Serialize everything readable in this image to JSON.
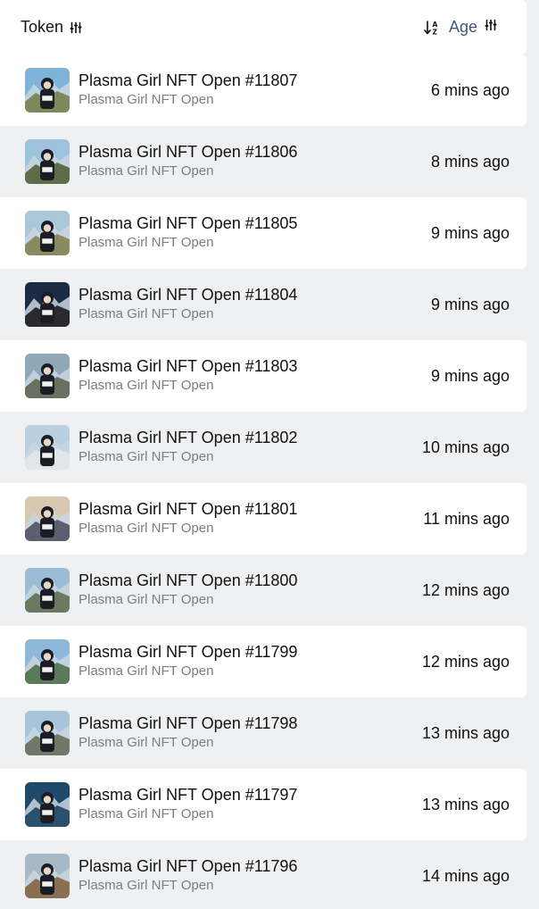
{
  "header": {
    "token_label": "Token",
    "age_label": "Age"
  },
  "rows": [
    {
      "name": "Plasma Girl NFT Open #11807",
      "collection": "Plasma Girl NFT Open",
      "age": "6 mins ago",
      "sky": "#7fb3d8",
      "ground": "#7a8a5a"
    },
    {
      "name": "Plasma Girl NFT Open #11806",
      "collection": "Plasma Girl NFT Open",
      "age": "8 mins ago",
      "sky": "#9cc2dd",
      "ground": "#5d6d4a"
    },
    {
      "name": "Plasma Girl NFT Open #11805",
      "collection": "Plasma Girl NFT Open",
      "age": "9 mins ago",
      "sky": "#a9c7d9",
      "ground": "#8a8a60"
    },
    {
      "name": "Plasma Girl NFT Open #11804",
      "collection": "Plasma Girl NFT Open",
      "age": "9 mins ago",
      "sky": "#1c2a44",
      "ground": "#2a2a30"
    },
    {
      "name": "Plasma Girl NFT Open #11803",
      "collection": "Plasma Girl NFT Open",
      "age": "9 mins ago",
      "sky": "#8fa8b8",
      "ground": "#6a7060"
    },
    {
      "name": "Plasma Girl NFT Open #11802",
      "collection": "Plasma Girl NFT Open",
      "age": "10 mins ago",
      "sky": "#b8d0e0",
      "ground": "#dfe6ea"
    },
    {
      "name": "Plasma Girl NFT Open #11801",
      "collection": "Plasma Girl NFT Open",
      "age": "11 mins ago",
      "sky": "#d8c8b0",
      "ground": "#5a6070"
    },
    {
      "name": "Plasma Girl NFT Open #11800",
      "collection": "Plasma Girl NFT Open",
      "age": "12 mins ago",
      "sky": "#9bbcd6",
      "ground": "#6a7a60"
    },
    {
      "name": "Plasma Girl NFT Open #11799",
      "collection": "Plasma Girl NFT Open",
      "age": "12 mins ago",
      "sky": "#8eb8da",
      "ground": "#5a7a5a"
    },
    {
      "name": "Plasma Girl NFT Open #11798",
      "collection": "Plasma Girl NFT Open",
      "age": "13 mins ago",
      "sky": "#a6c4da",
      "ground": "#707868"
    },
    {
      "name": "Plasma Girl NFT Open #11797",
      "collection": "Plasma Girl NFT Open",
      "age": "13 mins ago",
      "sky": "#1f4a6a",
      "ground": "#2a5070"
    },
    {
      "name": "Plasma Girl NFT Open #11796",
      "collection": "Plasma Girl NFT Open",
      "age": "14 mins ago",
      "sky": "#a8b8c4",
      "ground": "#8a7050"
    }
  ]
}
